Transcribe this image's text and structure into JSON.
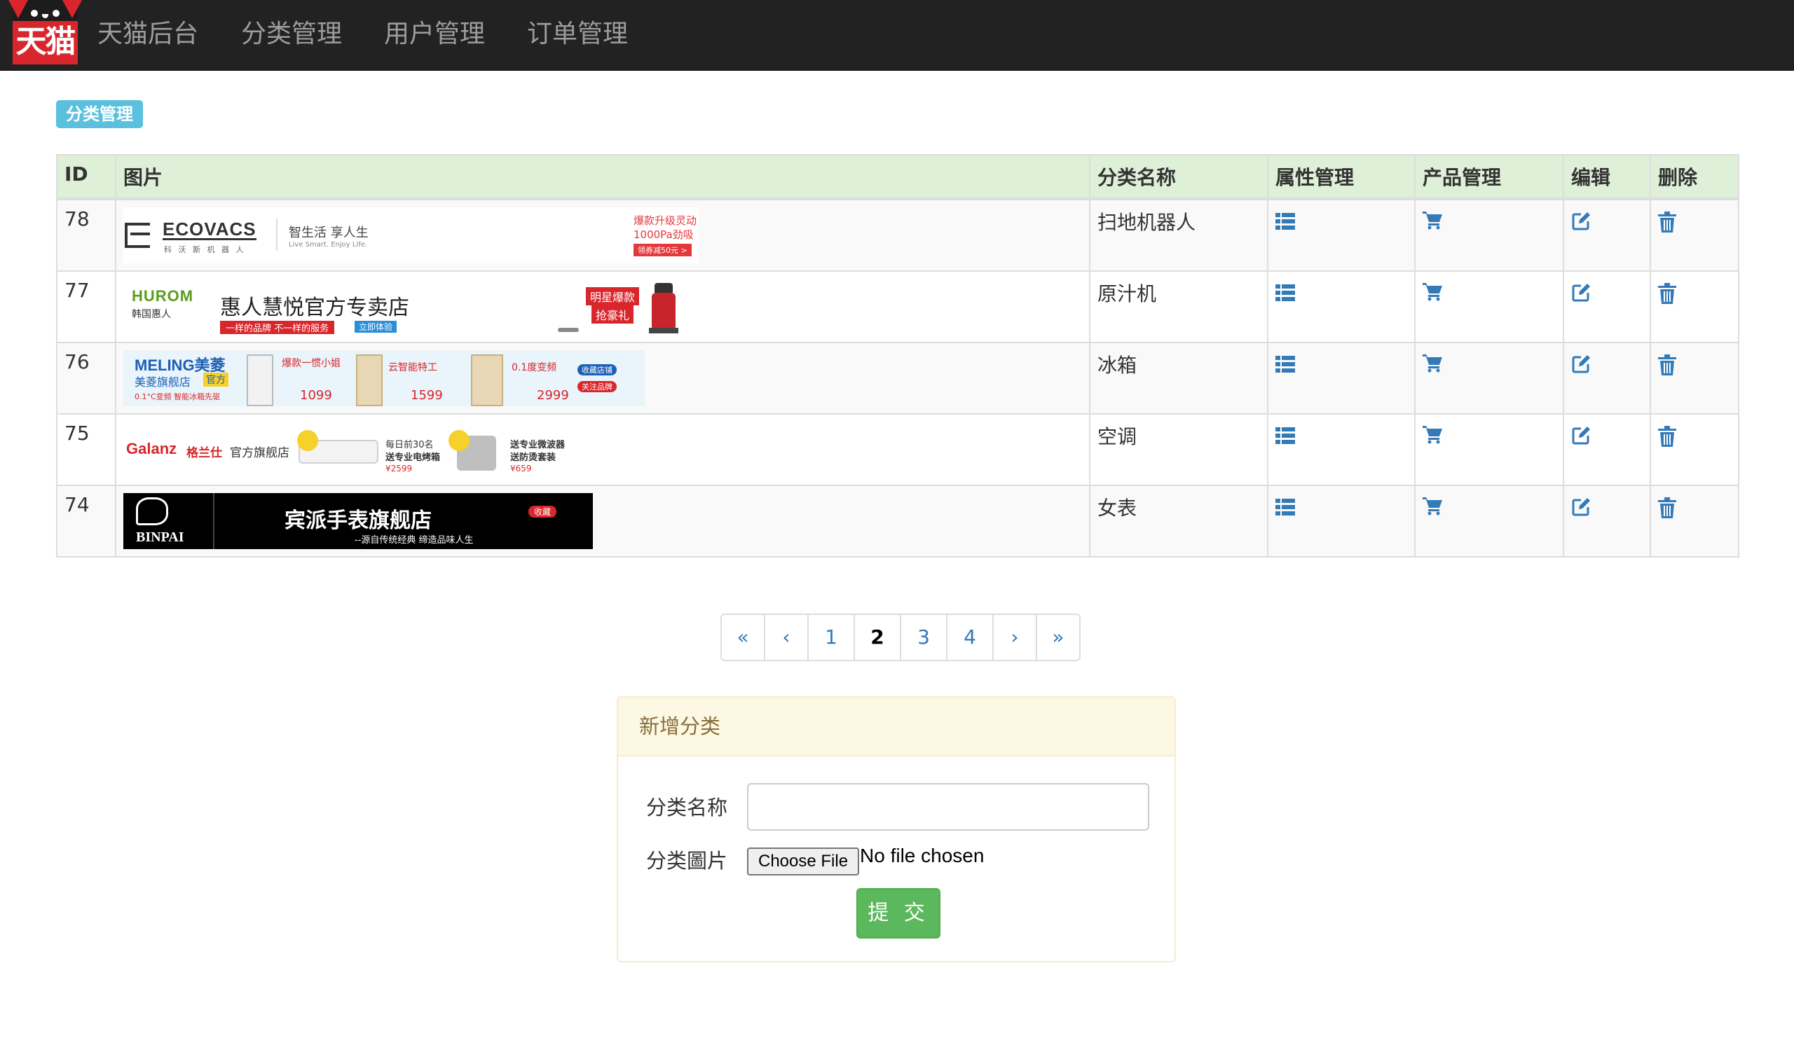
{
  "navbar": {
    "logo_text": "天猫",
    "links": [
      "天猫后台",
      "分类管理",
      "用户管理",
      "订单管理"
    ]
  },
  "page_label": "分类管理",
  "table": {
    "headers": [
      "ID",
      "图片",
      "分类名称",
      "属性管理",
      "产品管理",
      "编辑",
      "删除"
    ],
    "rows": [
      {
        "id": "78",
        "name": "扫地机器人",
        "banner": {
          "brand": "ECOVACS",
          "brand_sub": "科 沃 斯 机 器 人",
          "slogan": "智生活 享人生",
          "slogan_sub": "Live Smart. Enjoy Life.",
          "promo": "爆款升级灵动",
          "promo2": "1000Pa劲吸",
          "promo_tag": "领券减50元 >"
        }
      },
      {
        "id": "77",
        "name": "原汁机",
        "banner": {
          "brand": "HUROM",
          "brand_sub": "韩国惠人",
          "title": "惠人慧悦官方专卖店",
          "tagline": "一样的品牌 不一样的服务",
          "tag2": "立即体验",
          "promo": "明星爆款",
          "promo2": "抢豪礼"
        }
      },
      {
        "id": "76",
        "name": "冰箱",
        "banner": {
          "brand": "MELING美菱",
          "store": "美菱旗舰店",
          "badge": "官方",
          "tagline": "0.1°C变频 智能冰箱先驱",
          "p1": "爆款一惯小姐",
          "p1_price": "1099",
          "p2": "云智能特工",
          "p2_price": "1599",
          "p3": "0.1度变频",
          "p3_price": "2999",
          "fav": "收藏店铺",
          "follow": "关注品牌"
        }
      },
      {
        "id": "75",
        "name": "空调",
        "banner": {
          "brand": "Galanz",
          "brand_cn": "格兰仕",
          "store": "官方旗舰店",
          "p1": "每日前30名",
          "p1_b": "送专业电烤箱",
          "p1_price": "¥2599",
          "p2": "送专业微波器",
          "p2_b": "送防烫套装",
          "p2_price": "¥659"
        }
      },
      {
        "id": "74",
        "name": "女表",
        "banner": {
          "brand": "BINPAI",
          "title": "宾派手表旗舰店",
          "sub": "--源自传统经典 缔造品味人生",
          "fav": "收藏"
        }
      }
    ]
  },
  "pagination": [
    "«",
    "‹",
    "1",
    "2",
    "3",
    "4",
    "›",
    "»"
  ],
  "pagination_active": "2",
  "add_panel": {
    "heading": "新增分类",
    "name_label": "分类名称",
    "image_label": "分类圖片",
    "file_button": "Choose File",
    "file_status": "No file chosen",
    "submit": "提 交"
  },
  "colors": {
    "navbar": "#222222",
    "label": "#5bc0de",
    "table_header": "#dff0d8",
    "link": "#337ab7",
    "submit": "#5cb85c",
    "panel_heading": "#fcf8e3"
  }
}
